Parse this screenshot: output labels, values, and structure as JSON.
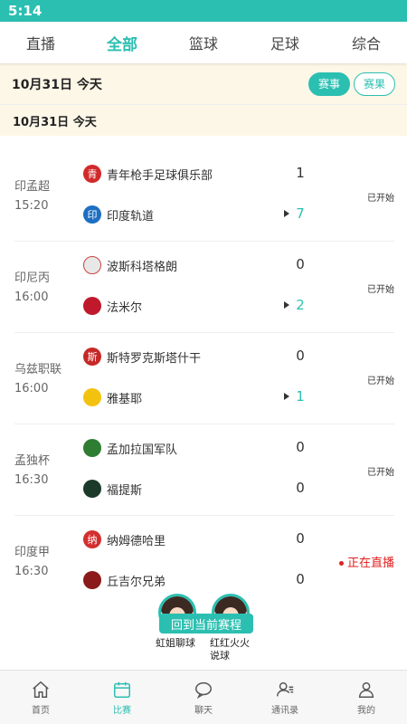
{
  "status_bar": {
    "time": "5:14"
  },
  "tabs": [
    {
      "label": "直播",
      "active": false
    },
    {
      "label": "全部",
      "active": true
    },
    {
      "label": "篮球",
      "active": false
    },
    {
      "label": "足球",
      "active": false
    },
    {
      "label": "综合",
      "active": false
    }
  ],
  "date_bar": {
    "date": "10月31日  今天",
    "btn_schedule": "赛事",
    "btn_results": "赛果"
  },
  "section": {
    "title": "10月31日   今天"
  },
  "matches": [
    {
      "league": "印孟超",
      "time": "15:20",
      "home": {
        "name": "青年枪手足球俱乐部",
        "badge": "青",
        "color": "#d12a2a",
        "score": "1"
      },
      "away": {
        "name": "印度轨道",
        "badge": "印",
        "color": "#1d6fc2",
        "score": "7"
      },
      "status": "已开始"
    },
    {
      "league": "印尼丙",
      "time": "16:00",
      "home": {
        "name": "波斯科塔格朗",
        "badge": "",
        "color": "#e8e8e8",
        "score": "0"
      },
      "away": {
        "name": "法米尔",
        "badge": "",
        "color": "#c0192c",
        "score": "2"
      },
      "status": "已开始"
    },
    {
      "league": "乌兹职联",
      "time": "16:00",
      "home": {
        "name": "斯特罗克斯塔什干",
        "badge": "斯",
        "color": "#c62828",
        "score": "0"
      },
      "away": {
        "name": "雅基耶",
        "badge": "",
        "color": "#f3c20e",
        "score": "1"
      },
      "status": "已开始"
    },
    {
      "league": "孟独杯",
      "time": "16:30",
      "home": {
        "name": "孟加拉国军队",
        "badge": "",
        "color": "#2e7d32",
        "score": "0"
      },
      "away": {
        "name": "福提斯",
        "badge": "",
        "color": "#1b3a2a",
        "score": "0"
      },
      "status": "已开始"
    },
    {
      "league": "印度甲",
      "time": "16:30",
      "home": {
        "name": "纳姆德哈里",
        "badge": "纳",
        "color": "#d32f2f",
        "score": "0"
      },
      "away": {
        "name": "丘吉尔兄弟",
        "badge": "",
        "color": "#8b1a1a",
        "score": "0"
      },
      "status": "正在直播"
    }
  ],
  "floating": {
    "return_label": "回到当前赛程",
    "anchor1": "虹姐聊球",
    "anchor2": "红红火火说球"
  },
  "bottom_nav": [
    {
      "label": "首页",
      "icon": "home-icon",
      "active": false
    },
    {
      "label": "比赛",
      "icon": "calendar-icon",
      "active": true
    },
    {
      "label": "聊天",
      "icon": "chat-icon",
      "active": false
    },
    {
      "label": "通讯录",
      "icon": "contacts-icon",
      "active": false
    },
    {
      "label": "我的",
      "icon": "profile-icon",
      "active": false
    }
  ],
  "colors": {
    "accent": "#2bbfb1",
    "live": "#e02020",
    "date_bg": "#fdf7e8"
  }
}
